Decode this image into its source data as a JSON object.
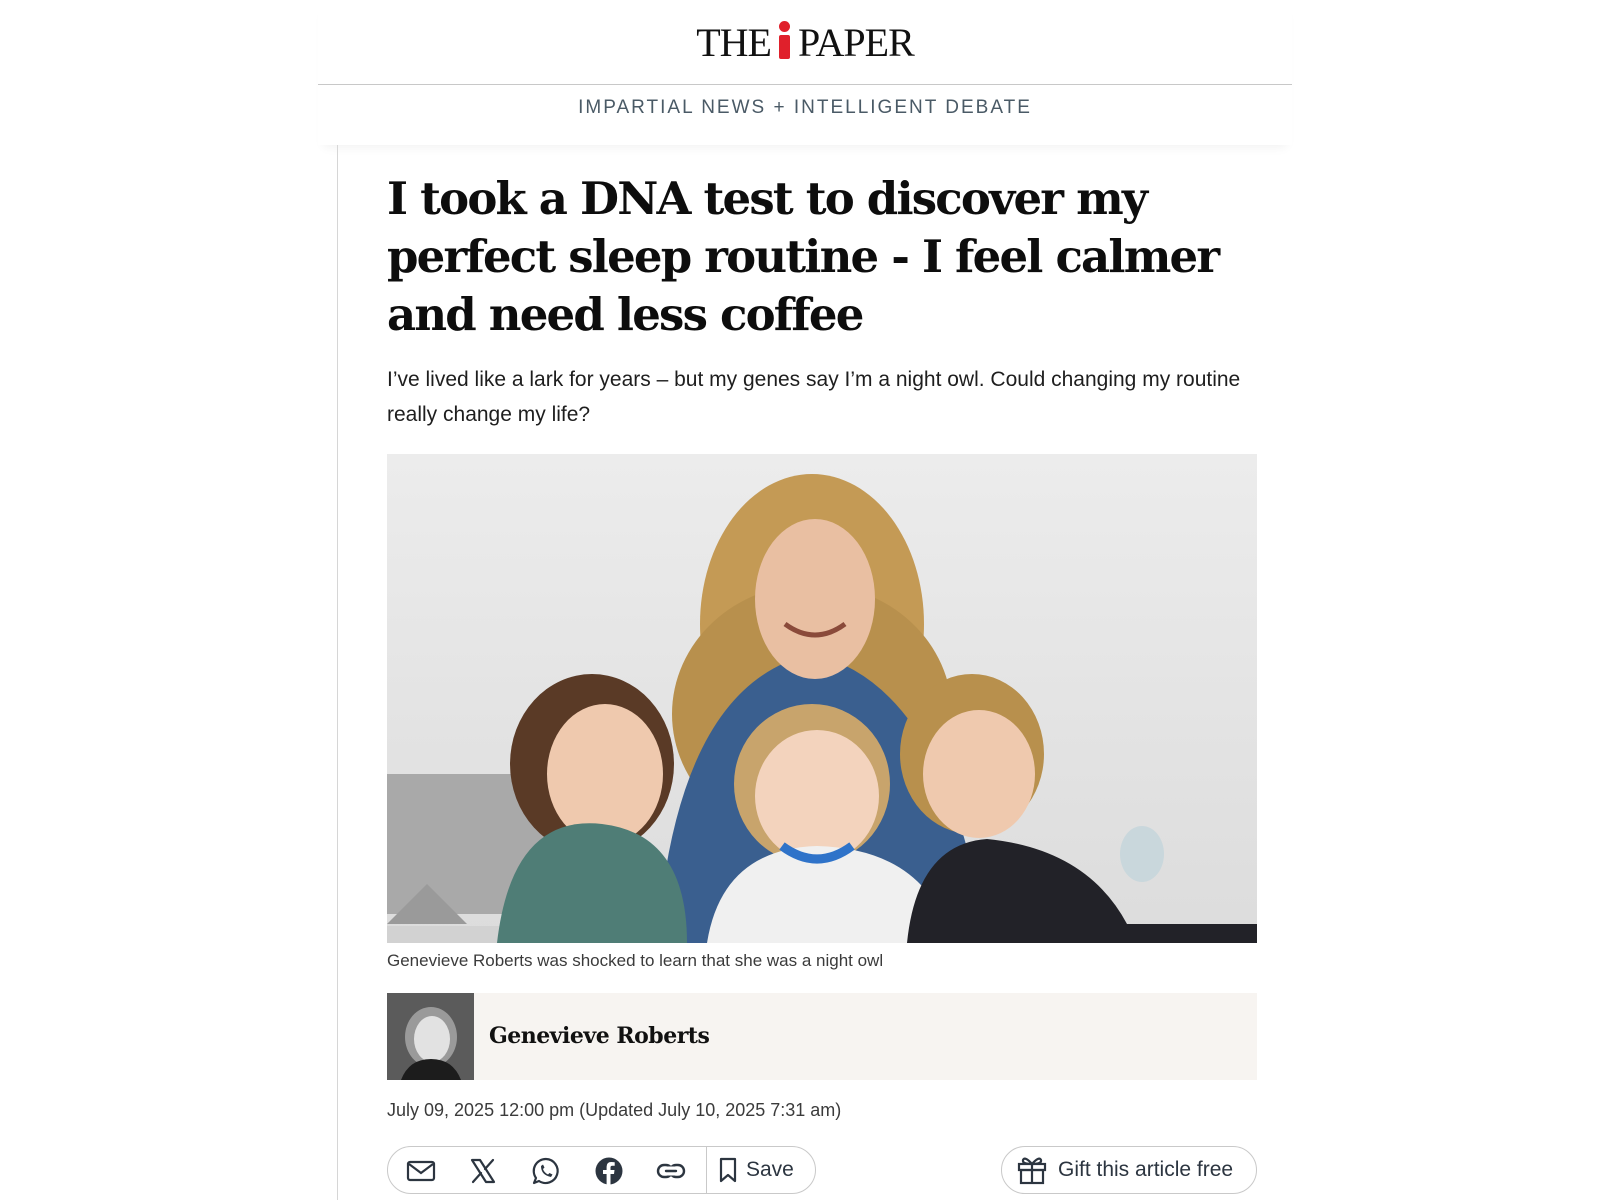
{
  "masthead": {
    "logo_left": "THE",
    "logo_right": "PAPER",
    "logo_accent": "#e0202b",
    "tagline": "IMPARTIAL NEWS + INTELLIGENT DEBATE"
  },
  "article": {
    "headline": "I took a DNA test to discover my perfect sleep routine - I feel calmer and need less coffee",
    "standfirst": "I’ve lived like a lark for years – but my genes say I’m a night owl. Could changing my routine really change my life?",
    "caption": "Genevieve Roberts was shocked to learn that she was a night owl",
    "author": "Genevieve Roberts",
    "dateline": "July 09, 2025 12:00 pm (Updated July 10, 2025 7:31 am)"
  },
  "share": {
    "icons": [
      "email-icon",
      "x-icon",
      "whatsapp-icon",
      "facebook-icon",
      "link-icon"
    ],
    "save_label": "Save",
    "gift_label": "Gift this article free"
  },
  "colors": {
    "icon": "#2c3540",
    "author_box_bg": "#f7f4f1",
    "tagline": "#4a5a66"
  }
}
